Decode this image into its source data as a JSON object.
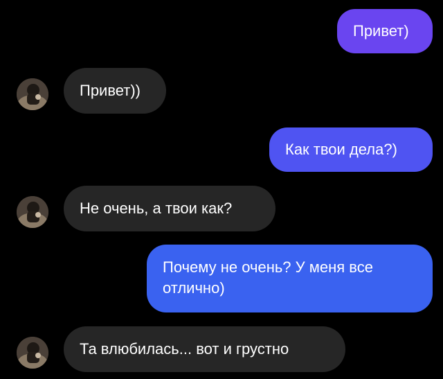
{
  "colors": {
    "background": "#000000",
    "incoming_bubble": "#262626",
    "outgoing_gradient": [
      "#6a45f0",
      "#4a56f2",
      "#3665f0"
    ],
    "text": "#ffffff"
  },
  "messages": [
    {
      "direction": "outgoing",
      "text": "Привет)"
    },
    {
      "direction": "incoming",
      "text": "Привет))"
    },
    {
      "direction": "outgoing",
      "text": "Как твои дела?)"
    },
    {
      "direction": "incoming",
      "text": "Не очень, а твои как?"
    },
    {
      "direction": "outgoing",
      "text": "Почему не очень? У меня все отлично)"
    },
    {
      "direction": "incoming",
      "text": "Та влюбилась... вот и грустно"
    }
  ],
  "avatar": {
    "icon": "contact-avatar"
  }
}
